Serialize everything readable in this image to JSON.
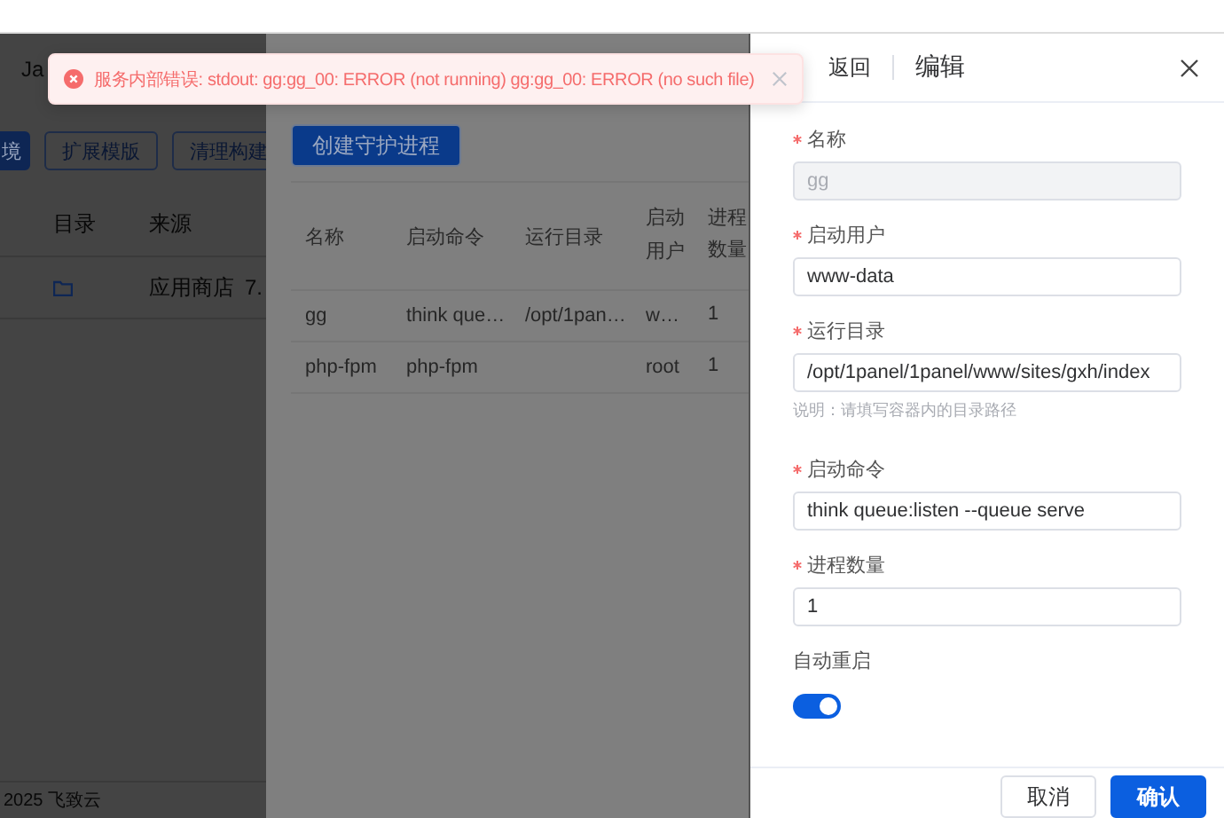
{
  "toast": {
    "kind": "error",
    "message": "服务内部错误: stdout: gg:gg_00: ERROR (not running) gg:gg_00: ERROR (no such file)"
  },
  "page": {
    "title": "Ja",
    "buttons": [
      {
        "label": "境",
        "primary": true
      },
      {
        "label": "扩展模版",
        "primary": false
      },
      {
        "label": "清理构建",
        "primary": false
      }
    ],
    "columns": [
      "目录",
      "来源"
    ],
    "rows": [
      {
        "source": "应用商店",
        "version": "7."
      }
    ],
    "footer": "2025 飞致云"
  },
  "process_drawer": {
    "create_button": "创建守护进程",
    "columns": [
      "名称",
      "启动命令",
      "运行目录",
      "启动用户",
      "进程数量"
    ],
    "rows": [
      {
        "name": "gg",
        "command": "think que…",
        "directory": "/opt/1pan…",
        "user": "w…",
        "count": "1"
      },
      {
        "name": "php-fpm",
        "command": "php-fpm",
        "user": "root",
        "count": "1"
      }
    ]
  },
  "edit_drawer": {
    "back": "返回",
    "title": "编辑",
    "fields": [
      {
        "label": "名称",
        "required": true,
        "value": "gg",
        "disabled": true
      },
      {
        "label": "启动用户",
        "required": true,
        "value": "www-data",
        "disabled": false
      },
      {
        "label": "运行目录",
        "required": true,
        "value": "/opt/1panel/1panel/www/sites/gxh/index",
        "disabled": false,
        "help": "说明：请填写容器内的目录路径"
      },
      {
        "label": "启动命令",
        "required": true,
        "value": "think queue:listen --queue serve",
        "disabled": false
      },
      {
        "label": "进程数量",
        "required": true,
        "value": "1",
        "disabled": false
      }
    ],
    "auto_restart": {
      "label": "自动重启",
      "on": true
    },
    "buttons": [
      {
        "label": "取消",
        "primary": false
      },
      {
        "label": "确认",
        "primary": true
      }
    ]
  }
}
